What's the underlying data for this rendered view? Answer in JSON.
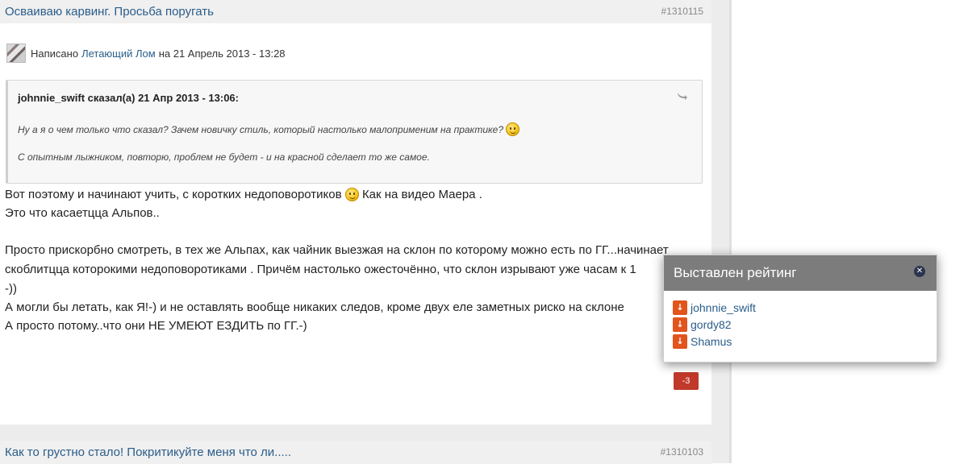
{
  "post1": {
    "title": "Осваиваю карвинг. Просьба поругать",
    "post_id": "#1310115",
    "author_prefix": "Написано",
    "author": "Летающий Лом",
    "date": "на 21 Апрель 2013 - 13:28"
  },
  "quote": {
    "header": "johnnie_swift сказал(а) 21 Апр 2013 - 13:06:",
    "line1": "Ну а я о чем только что сказал? Зачем новичку стиль, который настолько малоприменим на практике?",
    "line2": "С опытным лыжником, повторю, проблем не будет - и на красной сделает то же самое."
  },
  "body": {
    "line1a": "Вот поэтому и начинают учить, с коротких недоповоротиков",
    "line1b": "Как на видео Маера .",
    "line2": "Это что касаетцца Альпов..",
    "line3": "Просто прискорбно смотреть, в тех же Альпах, как чайник выезжая на склон по которому можно есть по ГГ...начинает",
    "line4": "скоблитцца которокими недоповоротиками . Причём настолько ожесточённо, что склон изрывают уже часам к 1",
    "line5": "-))",
    "line6": "А могли бы летать, как Я!-) и не оставлять вообще никаких следов, кроме двух еле заметных риско на склоне",
    "line7": "А просто потому..что они НЕ УМЕЮТ ЕЗДИТЬ по ГГ.-)"
  },
  "rating": {
    "value": "-3"
  },
  "popup": {
    "title": "Выставлен рейтинг",
    "close_icon": "close-icon",
    "users": [
      "johnnie_swift",
      "gordy82",
      "Shamus"
    ]
  },
  "post2": {
    "title": "Как то грустно стало! Покритикуйте меня что ли.....",
    "post_id": "#1310103"
  }
}
